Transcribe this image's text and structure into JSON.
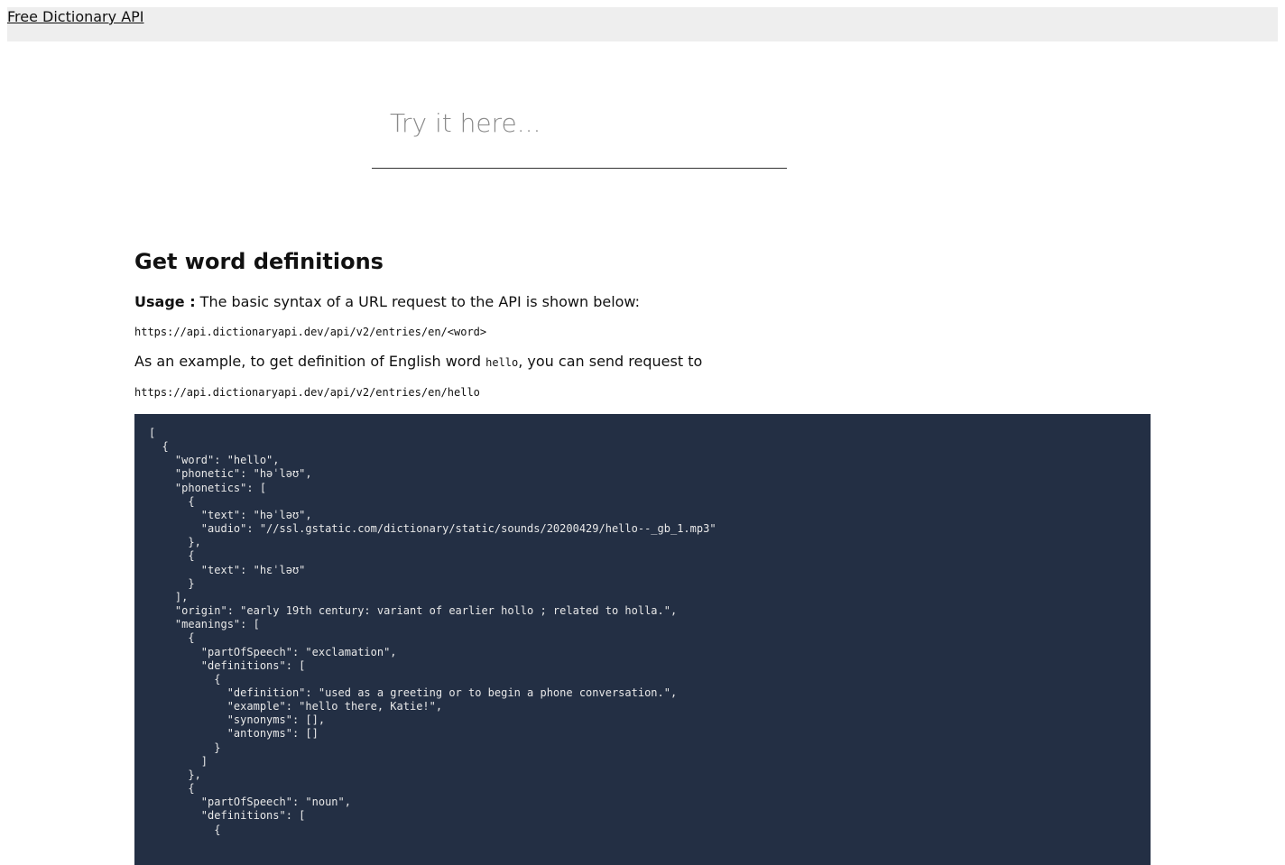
{
  "header": {
    "brand_link": "Free Dictionary API"
  },
  "search": {
    "placeholder": "Try it here..."
  },
  "section": {
    "title": "Get word definitions",
    "usage_label": "Usage :",
    "usage_text": " The basic syntax of a URL request to the API is shown below:",
    "syntax_url": "https://api.dictionaryapi.dev/api/v2/entries/en/<word>",
    "example_text_before": "As an example, to get definition of English word ",
    "example_word": "hello",
    "example_text_after": ", you can send request to",
    "example_url": "https://api.dictionaryapi.dev/api/v2/entries/en/hello",
    "response_code": "[\n  {\n    \"word\": \"hello\",\n    \"phonetic\": \"həˈləʊ\",\n    \"phonetics\": [\n      {\n        \"text\": \"həˈləʊ\",\n        \"audio\": \"//ssl.gstatic.com/dictionary/static/sounds/20200429/hello--_gb_1.mp3\"\n      },\n      {\n        \"text\": \"hɛˈləʊ\"\n      }\n    ],\n    \"origin\": \"early 19th century: variant of earlier hollo ; related to holla.\",\n    \"meanings\": [\n      {\n        \"partOfSpeech\": \"exclamation\",\n        \"definitions\": [\n          {\n            \"definition\": \"used as a greeting or to begin a phone conversation.\",\n            \"example\": \"hello there, Katie!\",\n            \"synonyms\": [],\n            \"antonyms\": []\n          }\n        ]\n      },\n      {\n        \"partOfSpeech\": \"noun\",\n        \"definitions\": [\n          {"
  },
  "colors": {
    "header_bg": "#eeeeee",
    "code_bg": "#232f44",
    "code_text": "#e8e8e8"
  }
}
